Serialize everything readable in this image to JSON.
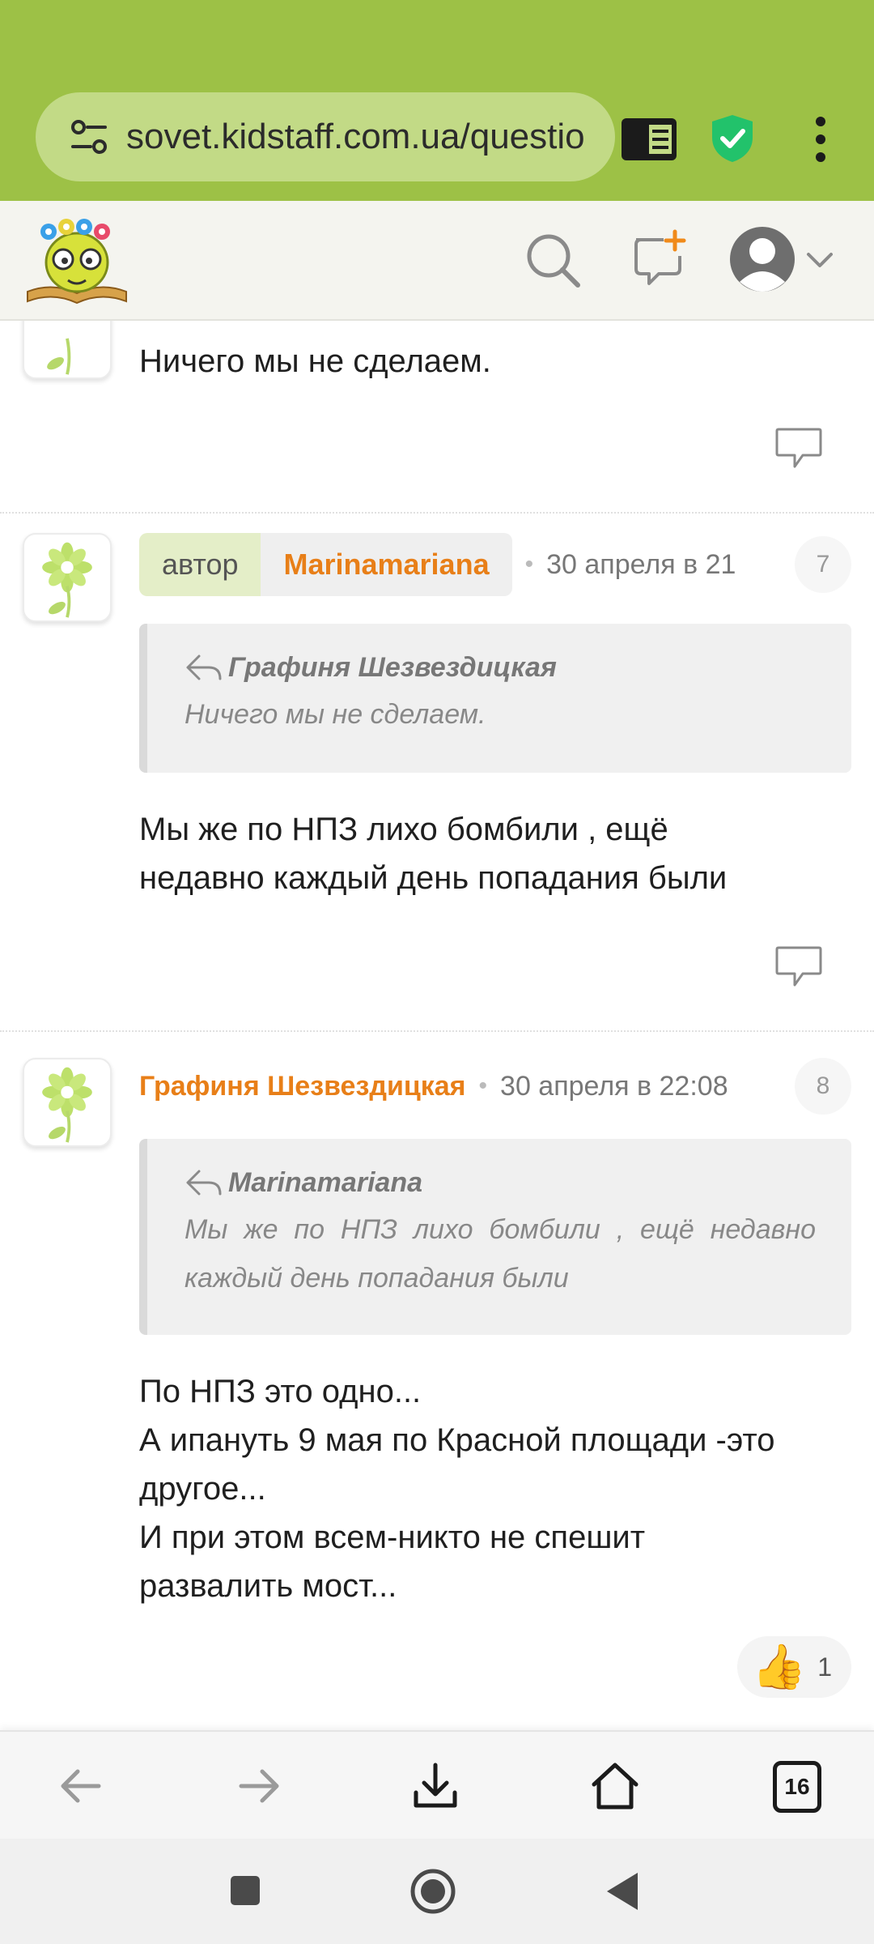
{
  "browser": {
    "url": "sovet.kidstaff.com.ua/questio",
    "tabs_count": "16",
    "theme_color": "#9dc146"
  },
  "posts": [
    {
      "text": "Ничего мы не сделаем."
    },
    {
      "author_badge": "автор",
      "author": "Marinamariana",
      "date": "30 апреля в 21",
      "number": "7",
      "quote_author": "Графиня Шезвездицкая",
      "quote_text": "Ничего мы не сделаем.",
      "text_lines": [
        "Мы же по НПЗ лихо бомбили , ещё",
        "недавно каждый день попадания были"
      ]
    },
    {
      "author": "Графиня Шезвездицкая",
      "date": "30 апреля в 22:08",
      "number": "8",
      "quote_author": "Marinamariana",
      "quote_text": "Мы же по НПЗ лихо бомбили , ещё недавно каждый день попадания были",
      "text_lines": [
        "По НПЗ это одно...",
        "А ипануть 9 мая по Красной площади -это",
        "другое...",
        "И при этом всем-никто не спешит",
        "развалить мост..."
      ],
      "likes": "1",
      "like_icon": "👍"
    }
  ],
  "colors": {
    "accent_orange": "#e87f18",
    "author_badge_bg": "#e4eec8"
  }
}
